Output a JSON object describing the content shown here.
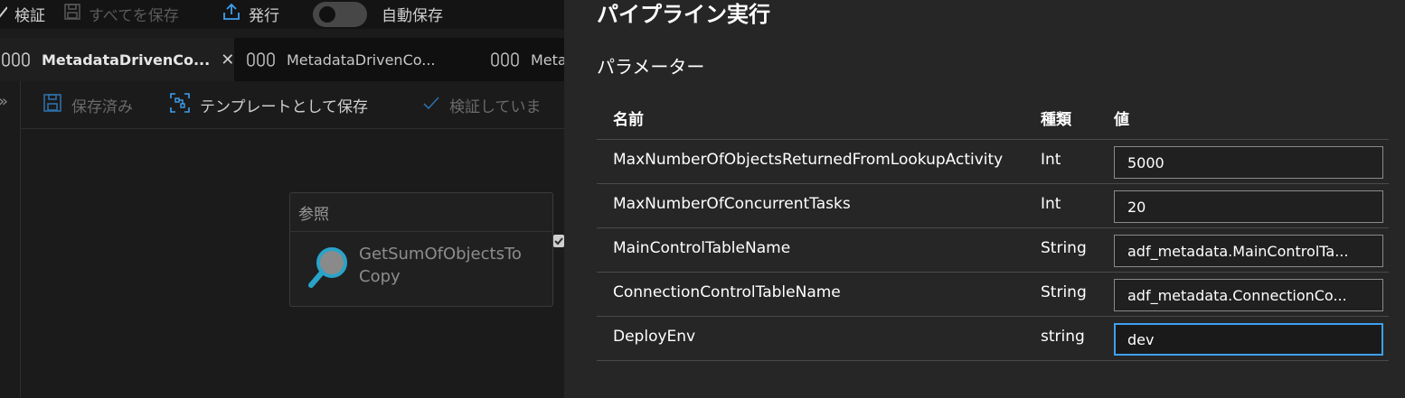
{
  "toolbar": {
    "validate_label": "検証",
    "save_all_label": "すべてを保存",
    "publish_label": "発行",
    "autosave_label": "自動保存",
    "autosave_on": false
  },
  "tabs": [
    {
      "label": "MetadataDrivenCo...",
      "active": true
    },
    {
      "label": "MetadataDrivenCo...",
      "active": false
    },
    {
      "label": "Meta",
      "active": false
    }
  ],
  "pipeline_toolbar": {
    "saved_label": "保存済み",
    "save_template_label": "テンプレートとして保存",
    "validating_label": "検証していま"
  },
  "activity": {
    "category": "参照",
    "name": "GetSumOfObjectsToCopy"
  },
  "panel": {
    "title": "パイプライン実行",
    "subtitle": "パラメーター",
    "columns": {
      "name": "名前",
      "type": "種類",
      "value": "値"
    },
    "parameters": [
      {
        "name": "MaxNumberOfObjectsReturnedFromLookupActivity",
        "type": "Int",
        "value": "5000"
      },
      {
        "name": "MaxNumberOfConcurrentTasks",
        "type": "Int",
        "value": "20"
      },
      {
        "name": "MainControlTableName",
        "type": "String",
        "value": "adf_metadata.MainControlTa..."
      },
      {
        "name": "ConnectionControlTableName",
        "type": "String",
        "value": "adf_metadata.ConnectionCo..."
      },
      {
        "name": "DeployEnv",
        "type": "string",
        "value": "dev",
        "focused": true
      }
    ]
  },
  "colors": {
    "accent": "#3ea0f0",
    "panel_bg": "#262626",
    "canvas_bg": "#1b1b1b",
    "lookup_icon": "#2aa3c8"
  }
}
